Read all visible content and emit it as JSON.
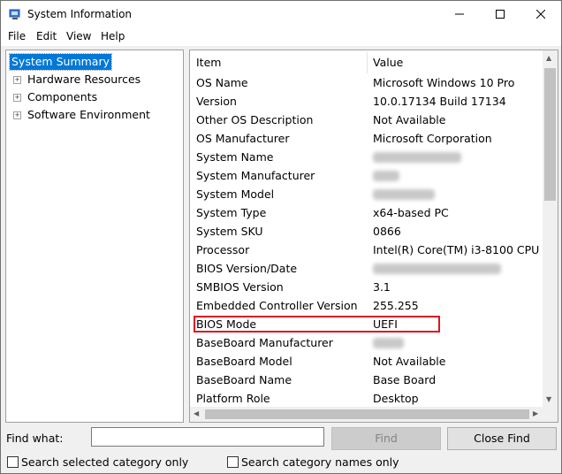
{
  "window": {
    "title": "System Information"
  },
  "menu": [
    "File",
    "Edit",
    "View",
    "Help"
  ],
  "tree": {
    "selected": "System Summary",
    "nodes": [
      "Hardware Resources",
      "Components",
      "Software Environment"
    ]
  },
  "list": {
    "headers": {
      "item": "Item",
      "value": "Value"
    },
    "rows": [
      {
        "item": "OS Name",
        "value": "Microsoft Windows 10 Pro"
      },
      {
        "item": "Version",
        "value": "10.0.17134 Build 17134"
      },
      {
        "item": "Other OS Description",
        "value": "Not Available"
      },
      {
        "item": "OS Manufacturer",
        "value": "Microsoft Corporation"
      },
      {
        "item": "System Name",
        "value": ""
      },
      {
        "item": "System Manufacturer",
        "value": ""
      },
      {
        "item": "System Model",
        "value": ""
      },
      {
        "item": "System Type",
        "value": "x64-based PC"
      },
      {
        "item": "System SKU",
        "value": "0866"
      },
      {
        "item": "Processor",
        "value": "Intel(R) Core(TM) i3-8100 CPU @"
      },
      {
        "item": "BIOS Version/Date",
        "value": ""
      },
      {
        "item": "SMBIOS Version",
        "value": "3.1"
      },
      {
        "item": "Embedded Controller Version",
        "value": "255.255"
      },
      {
        "item": "BIOS Mode",
        "value": "UEFI"
      },
      {
        "item": "BaseBoard Manufacturer",
        "value": ""
      },
      {
        "item": "BaseBoard Model",
        "value": "Not Available"
      },
      {
        "item": "BaseBoard Name",
        "value": "Base Board"
      },
      {
        "item": "Platform Role",
        "value": "Desktop"
      }
    ]
  },
  "search": {
    "find_label": "Find what:",
    "find_value": "",
    "find_button": "Find",
    "close_button": "Close Find",
    "check_selected": "Search selected category only",
    "check_names": "Search category names only"
  },
  "colors": {
    "selection": "#0078d7",
    "highlight_box": "#e0141e"
  }
}
